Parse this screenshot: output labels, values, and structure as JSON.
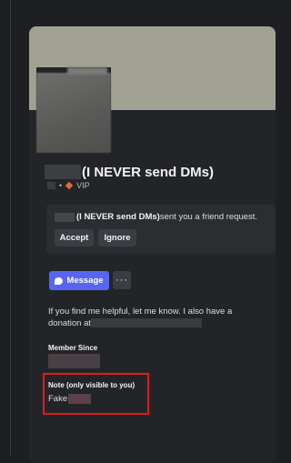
{
  "profile": {
    "display_name": "(I NEVER send DMs)",
    "sub_label": "VIP",
    "bio_line1": "If you find me helpful, let me know. I also have a",
    "bio_line2": "donation at"
  },
  "friend_request": {
    "name": "(I NEVER send DMs)",
    "message": " sent you a friend request.",
    "accept_label": "Accept",
    "ignore_label": "Ignore"
  },
  "actions": {
    "message_label": "Message",
    "more_label": "···"
  },
  "sections": {
    "member_since_label": "Member Since",
    "note_label": "Note (only visible to you)",
    "note_value": "Fake"
  },
  "colors": {
    "banner": "#a1a193",
    "accent": "#5865f2",
    "highlight_border": "#e11c1c",
    "vip_diamond": "#e8673c"
  }
}
